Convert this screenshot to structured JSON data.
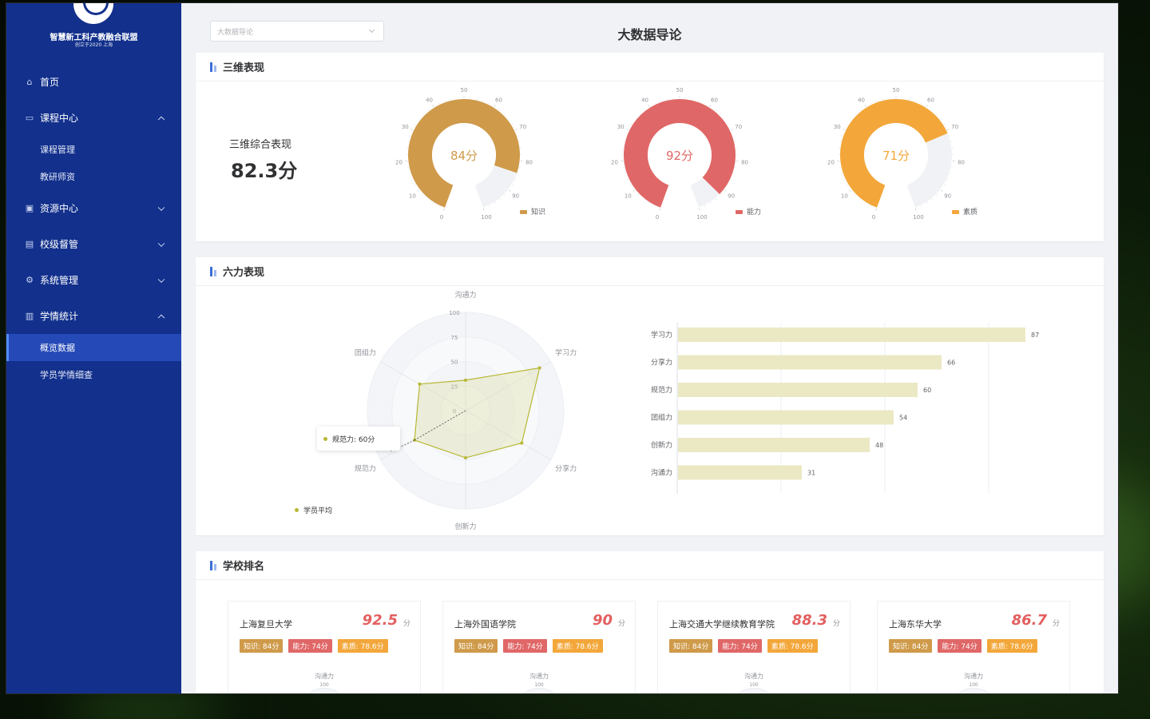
{
  "sidebar": {
    "logo_title": "智慧新工科产教融合联盟",
    "logo_sub": "创立于2020 上海",
    "items": [
      {
        "label": "首页",
        "icon": "home-icon"
      },
      {
        "label": "课程中心",
        "icon": "book-icon",
        "expanded": true,
        "children": [
          "课程管理",
          "教研师资"
        ]
      },
      {
        "label": "资源中心",
        "icon": "folder-icon",
        "expanded": false
      },
      {
        "label": "校级督管",
        "icon": "building-icon",
        "expanded": false
      },
      {
        "label": "系统管理",
        "icon": "gear-icon",
        "expanded": false
      },
      {
        "label": "学情统计",
        "icon": "chart-icon",
        "expanded": true,
        "children": [
          "概览数据",
          "学员学情细查"
        ]
      }
    ],
    "active_child": "概览数据"
  },
  "header": {
    "select_value": "大数据导论",
    "title": "大数据导论"
  },
  "three_dim": {
    "title": "三维表现",
    "overall_label": "三维综合表现",
    "overall_value": "82.3分",
    "gauges": [
      {
        "label": "84分",
        "value": 84,
        "legend": "知识",
        "color": "#cf9a4a"
      },
      {
        "label": "92分",
        "value": 92,
        "legend": "能力",
        "color": "#e06767"
      },
      {
        "label": "71分",
        "value": 71,
        "legend": "素质",
        "color": "#f3a73a"
      }
    ],
    "ticks": [
      "0",
      "10",
      "20",
      "30",
      "40",
      "50",
      "60",
      "70",
      "80",
      "90",
      "100"
    ]
  },
  "six_power": {
    "title": "六力表现",
    "radar": {
      "axes": [
        "沟通力",
        "学习力",
        "分享力",
        "创新力",
        "规范力",
        "团组力"
      ],
      "values": [
        31,
        87,
        66,
        48,
        60,
        54
      ],
      "rings": [
        "0",
        "25",
        "50",
        "75",
        "100"
      ],
      "series_name": "学员平均",
      "tooltip": "规范力:  60分",
      "color": "#b7b833"
    },
    "bars": {
      "categories": [
        "学习力",
        "分享力",
        "规范力",
        "团组力",
        "创新力",
        "沟通力"
      ],
      "values": [
        87,
        66,
        60,
        54,
        48,
        31
      ],
      "color": "#ebe8c4"
    }
  },
  "chart_data": [
    {
      "type": "radar",
      "categories": [
        "沟通力",
        "学习力",
        "分享力",
        "创新力",
        "规范力",
        "团组力"
      ],
      "series": [
        {
          "name": "学员平均",
          "values": [
            31,
            87,
            66,
            48,
            60,
            54
          ]
        }
      ],
      "ylim": [
        0,
        100
      ]
    },
    {
      "type": "bar",
      "orientation": "horizontal",
      "categories": [
        "学习力",
        "分享力",
        "规范力",
        "团组力",
        "创新力",
        "沟通力"
      ],
      "values": [
        87,
        66,
        60,
        54,
        48,
        31
      ]
    }
  ],
  "ranking": {
    "title": "学校排名",
    "unit": "分",
    "mini_label": "沟通力",
    "mini_num": "100",
    "schools": [
      {
        "name": "上海复旦大学",
        "score": "92.5",
        "knowledge": "知识: 84分",
        "ability": "能力: 74分",
        "quality": "素质: 78.6分"
      },
      {
        "name": "上海外国语学院",
        "score": "90",
        "knowledge": "知识: 84分",
        "ability": "能力: 74分",
        "quality": "素质: 78.6分"
      },
      {
        "name": "上海交通大学继续教育学院",
        "score": "88.3",
        "knowledge": "知识: 84分",
        "ability": "能力: 74分",
        "quality": "素质: 78.6分"
      },
      {
        "name": "上海东华大学",
        "score": "86.7",
        "knowledge": "知识: 84分",
        "ability": "能力: 74分",
        "quality": "素质: 78.6分"
      }
    ]
  }
}
